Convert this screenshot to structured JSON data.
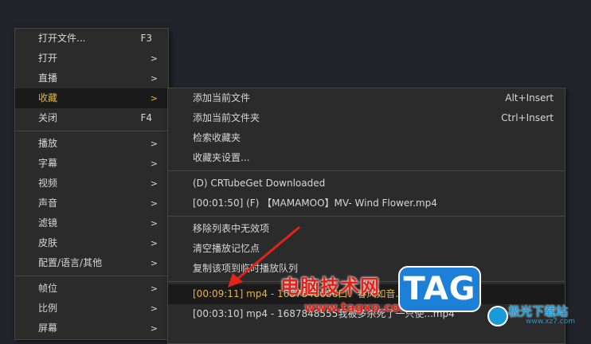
{
  "main_menu": {
    "items": [
      {
        "label": "打开文件...",
        "shortcut": "F3",
        "arrow": ""
      },
      {
        "label": "打开",
        "shortcut": "",
        "arrow": ">"
      },
      {
        "label": "直播",
        "shortcut": "",
        "arrow": ">"
      },
      {
        "label": "收藏",
        "shortcut": "",
        "arrow": ">"
      },
      {
        "label": "关闭",
        "shortcut": "F4",
        "arrow": ""
      },
      {
        "label": "播放",
        "shortcut": "",
        "arrow": ">"
      },
      {
        "label": "字幕",
        "shortcut": "",
        "arrow": ">"
      },
      {
        "label": "视频",
        "shortcut": "",
        "arrow": ">"
      },
      {
        "label": "声音",
        "shortcut": "",
        "arrow": ">"
      },
      {
        "label": "滤镜",
        "shortcut": "",
        "arrow": ">"
      },
      {
        "label": "皮肤",
        "shortcut": "",
        "arrow": ">"
      },
      {
        "label": "配置/语言/其他",
        "shortcut": "",
        "arrow": ">"
      },
      {
        "label": "帧位",
        "shortcut": "",
        "arrow": ">"
      },
      {
        "label": "比例",
        "shortcut": "",
        "arrow": ">"
      },
      {
        "label": "屏幕",
        "shortcut": "",
        "arrow": ">"
      }
    ]
  },
  "sub_menu": {
    "items": [
      {
        "label": "添加当前文件",
        "shortcut": "Alt+Insert"
      },
      {
        "label": "添加当前文件夹",
        "shortcut": "Ctrl+Insert"
      },
      {
        "label": "检索收藏夹",
        "shortcut": ""
      },
      {
        "label": "收藏夹设置...",
        "shortcut": ""
      },
      {
        "label": "(D) CRTubeGet Downloaded",
        "shortcut": ""
      },
      {
        "label": "[00:01:50] (F) 【MAMAMOO】MV- Wind Flower.mp4",
        "shortcut": ""
      },
      {
        "label": "移除列表中无效项",
        "shortcut": ""
      },
      {
        "label": "清空播放记忆点",
        "shortcut": ""
      },
      {
        "label": "复制该项到临时播放队列",
        "shortcut": ""
      },
      {
        "label": "[00:09:11] mp4 - 1687848086口：春风如音.mp4",
        "shortcut": ""
      },
      {
        "label": "[00:03:10] mp4 - 1687848555我被多杀死了一只使...mp4",
        "shortcut": ""
      }
    ]
  },
  "watermark": {
    "site_text": "电脑技术网",
    "site_url": "www.tagxp.com",
    "tag_logo": "TAG",
    "xz7_text": "极光下载站",
    "xz7_url": "www.xz7.com"
  },
  "colors": {
    "highlight_text": "#e3b447",
    "annotation_arrow": "#e2231a"
  }
}
